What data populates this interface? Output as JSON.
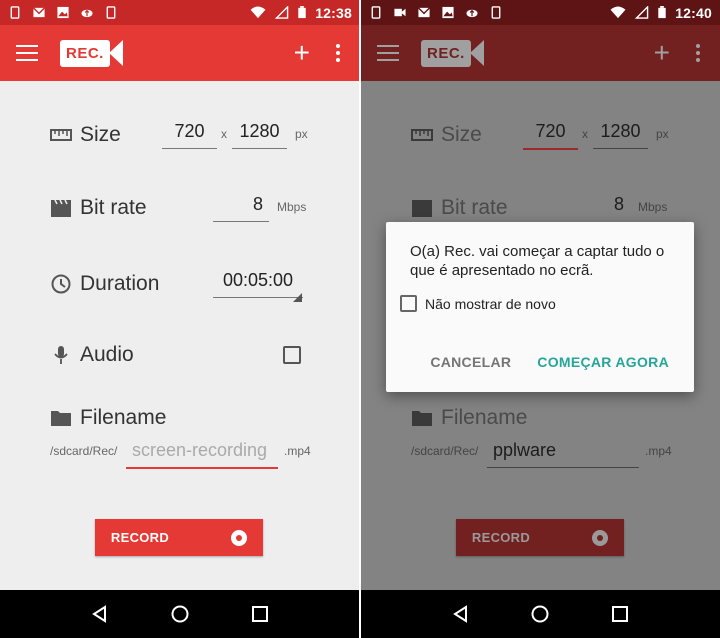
{
  "status_left": {
    "time": "12:38"
  },
  "status_right": {
    "time": "12:40"
  },
  "app": {
    "logo_text": "REC."
  },
  "size": {
    "label": "Size",
    "width": "720",
    "sep": "x",
    "height": "1280",
    "unit": "px"
  },
  "bitrate": {
    "label": "Bit rate",
    "value": "8",
    "unit": "Mbps"
  },
  "duration": {
    "label": "Duration",
    "value": "00:05:00"
  },
  "audio": {
    "label": "Audio",
    "checked": false
  },
  "filename": {
    "label": "Filename",
    "dir": "/sdcard/Rec/",
    "placeholder": "screen-recording",
    "value_right": "pplware",
    "ext": ".mp4"
  },
  "record_button": {
    "label": "RECORD"
  },
  "dialog": {
    "message": "O(a) Rec. vai começar a captar tudo o que é apresentado no ecrã.",
    "checkbox_label": "Não mostrar de novo",
    "cancel": "CANCELAR",
    "confirm": "COMEÇAR AGORA"
  },
  "colors": {
    "primary": "#e53935",
    "status": "#c62828",
    "accent": "#26a69a",
    "background": "#eeeeee"
  }
}
